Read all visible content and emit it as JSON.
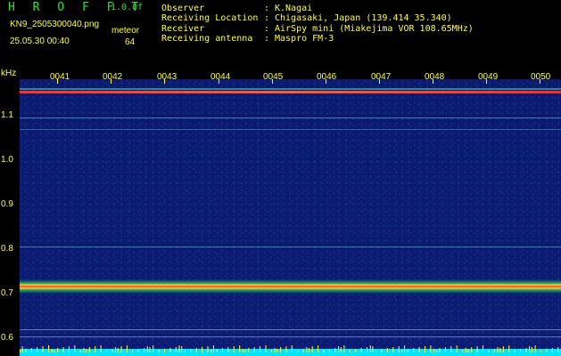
{
  "app": {
    "title": "H R O F F T",
    "version": "1.0.0f"
  },
  "file_name": "KN9_2505300040.png",
  "datetime": "25.05.30 00:40",
  "station": "meteor",
  "gain": "64",
  "info": {
    "observer_label": "Observer",
    "observer_value": "K.Nagai",
    "location_label": "Receiving Location",
    "location_value": "Chigasaki, Japan (139.414 35.340)",
    "receiver_label": "Receiver",
    "receiver_value": "AirSpy mini (Miakejima VOR 108.65MHz)",
    "antenna_label": "Receiving antenna",
    "antenna_value": "Maspro FM-3",
    "separator": ":"
  },
  "plot": {
    "y_unit": "kHz",
    "y_ticks": [
      "1.1",
      "1.0",
      "0.9",
      "0.8",
      "0.7",
      "0.6"
    ],
    "x_ticks": [
      "0041",
      "0042",
      "0043",
      "0044",
      "0045",
      "0046",
      "0047",
      "0048",
      "0049",
      "0050"
    ],
    "colors": {
      "background": "#0b1c72",
      "strong_band": "#ff2a2a",
      "mid_band": "#2bd36a",
      "baseline": "#00e5ff",
      "tick": "#ffff33"
    }
  }
}
